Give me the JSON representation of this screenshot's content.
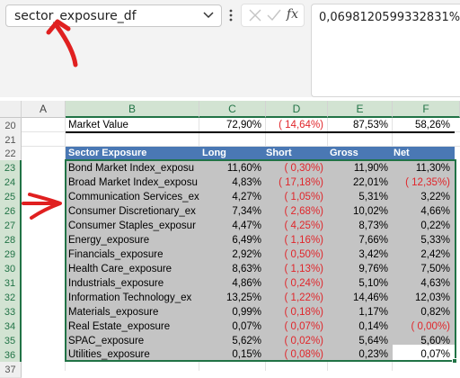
{
  "name_box": {
    "value": "sector_exposure_df"
  },
  "formula_bar": {
    "value": "0,0698120599332831%",
    "fx_label": "fx"
  },
  "columns": [
    "A",
    "B",
    "C",
    "D",
    "E",
    "F"
  ],
  "rows": [
    "20",
    "21",
    "22",
    "23",
    "24",
    "25",
    "26",
    "27",
    "28",
    "29",
    "30",
    "31",
    "32",
    "33",
    "34",
    "35",
    "36",
    "37"
  ],
  "market_value": {
    "label": "Market Value",
    "long": "72,90%",
    "short": "( 14,64%)",
    "gross": "87,53%",
    "net": "58,26%"
  },
  "table": {
    "headers": [
      "Sector Exposure",
      "Long",
      "Short",
      "Gross",
      "Net"
    ],
    "rows": [
      [
        "Bond Market Index_exposu",
        "11,60%",
        "( 0,30%)",
        "11,90%",
        "11,30%"
      ],
      [
        "Broad Market Index_exposu",
        "4,83%",
        "( 17,18%)",
        "22,01%",
        "( 12,35%)"
      ],
      [
        "Communication Services_ex",
        "4,27%",
        "( 1,05%)",
        "5,31%",
        "3,22%"
      ],
      [
        "Consumer Discretionary_ex",
        "7,34%",
        "( 2,68%)",
        "10,02%",
        "4,66%"
      ],
      [
        "Consumer Staples_exposur",
        "4,47%",
        "( 4,25%)",
        "8,73%",
        "0,22%"
      ],
      [
        "Energy_exposure",
        "6,49%",
        "( 1,16%)",
        "7,66%",
        "5,33%"
      ],
      [
        "Financials_exposure",
        "2,92%",
        "( 0,50%)",
        "3,42%",
        "2,42%"
      ],
      [
        "Health Care_exposure",
        "8,63%",
        "( 1,13%)",
        "9,76%",
        "7,50%"
      ],
      [
        "Industrials_exposure",
        "4,86%",
        "( 0,24%)",
        "5,10%",
        "4,63%"
      ],
      [
        "Information Technology_ex",
        "13,25%",
        "( 1,22%)",
        "14,46%",
        "12,03%"
      ],
      [
        "Materials_exposure",
        "0,99%",
        "( 0,18%)",
        "1,17%",
        "0,82%"
      ],
      [
        "Real Estate_exposure",
        "0,07%",
        "( 0,07%)",
        "0,14%",
        "( 0,00%)"
      ],
      [
        "SPAC_exposure",
        "5,62%",
        "( 0,02%)",
        "5,64%",
        "5,60%"
      ],
      [
        "Utilities_exposure",
        "0,15%",
        "( 0,08%)",
        "0,23%",
        "0,07%"
      ]
    ]
  },
  "colors": {
    "header_fill": "#4a78b4",
    "selection_border": "#217346",
    "negative": "#e0262b",
    "annotation": "#e02020"
  },
  "icons": [
    "chevron-down-icon",
    "more-options-icon",
    "cancel-icon",
    "enter-icon",
    "insert-function-icon"
  ]
}
